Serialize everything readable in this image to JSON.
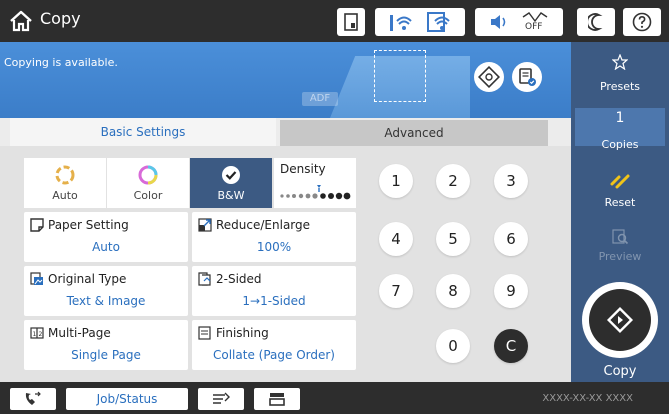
{
  "header": {
    "title": "Copy",
    "icons": [
      "home-icon",
      "document-icon",
      "wifi-icon",
      "wifi-direct-icon",
      "volume-icon",
      "eco-off-icon",
      "sleep-icon",
      "help-icon"
    ],
    "eco_label": "OFF"
  },
  "status": {
    "message": "Copying is available.",
    "adf_label": "ADF"
  },
  "tabs": [
    {
      "label": "Basic Settings",
      "active": true
    },
    {
      "label": "Advanced",
      "active": false
    }
  ],
  "color_modes": [
    {
      "label": "Auto",
      "selected": false
    },
    {
      "label": "Color",
      "selected": false
    },
    {
      "label": "B&W",
      "selected": true
    }
  ],
  "density": {
    "label": "Density",
    "level": 0.5
  },
  "settings": {
    "paper_setting": {
      "label": "Paper Setting",
      "value": "Auto"
    },
    "reduce_enlarge": {
      "label": "Reduce/Enlarge",
      "value": "100%"
    },
    "original_type": {
      "label": "Original Type",
      "value": "Text & Image"
    },
    "two_sided": {
      "label": "2-Sided",
      "value": "1→1-Sided"
    },
    "multi_page": {
      "label": "Multi-Page",
      "value": "Single Page"
    },
    "finishing": {
      "label": "Finishing",
      "value": "Collate (Page Order)"
    }
  },
  "keypad": [
    "1",
    "2",
    "3",
    "4",
    "5",
    "6",
    "7",
    "8",
    "9",
    "0",
    "C"
  ],
  "right_panel": {
    "presets_label": "Presets",
    "copies_count": "1",
    "copies_label": "Copies",
    "reset_label": "Reset",
    "preview_label": "Preview",
    "copy_label": "Copy"
  },
  "footer": {
    "job_status_label": "Job/Status",
    "clock_text": "XXXX-XX-XX  XXXX"
  },
  "colors": {
    "accent_blue": "#2a6fbe",
    "panel_navy": "#3c5a83",
    "bar_dark": "#2d2d2d",
    "status_blue": "#4b8fd9",
    "reset_yellow": "#f0c419"
  }
}
